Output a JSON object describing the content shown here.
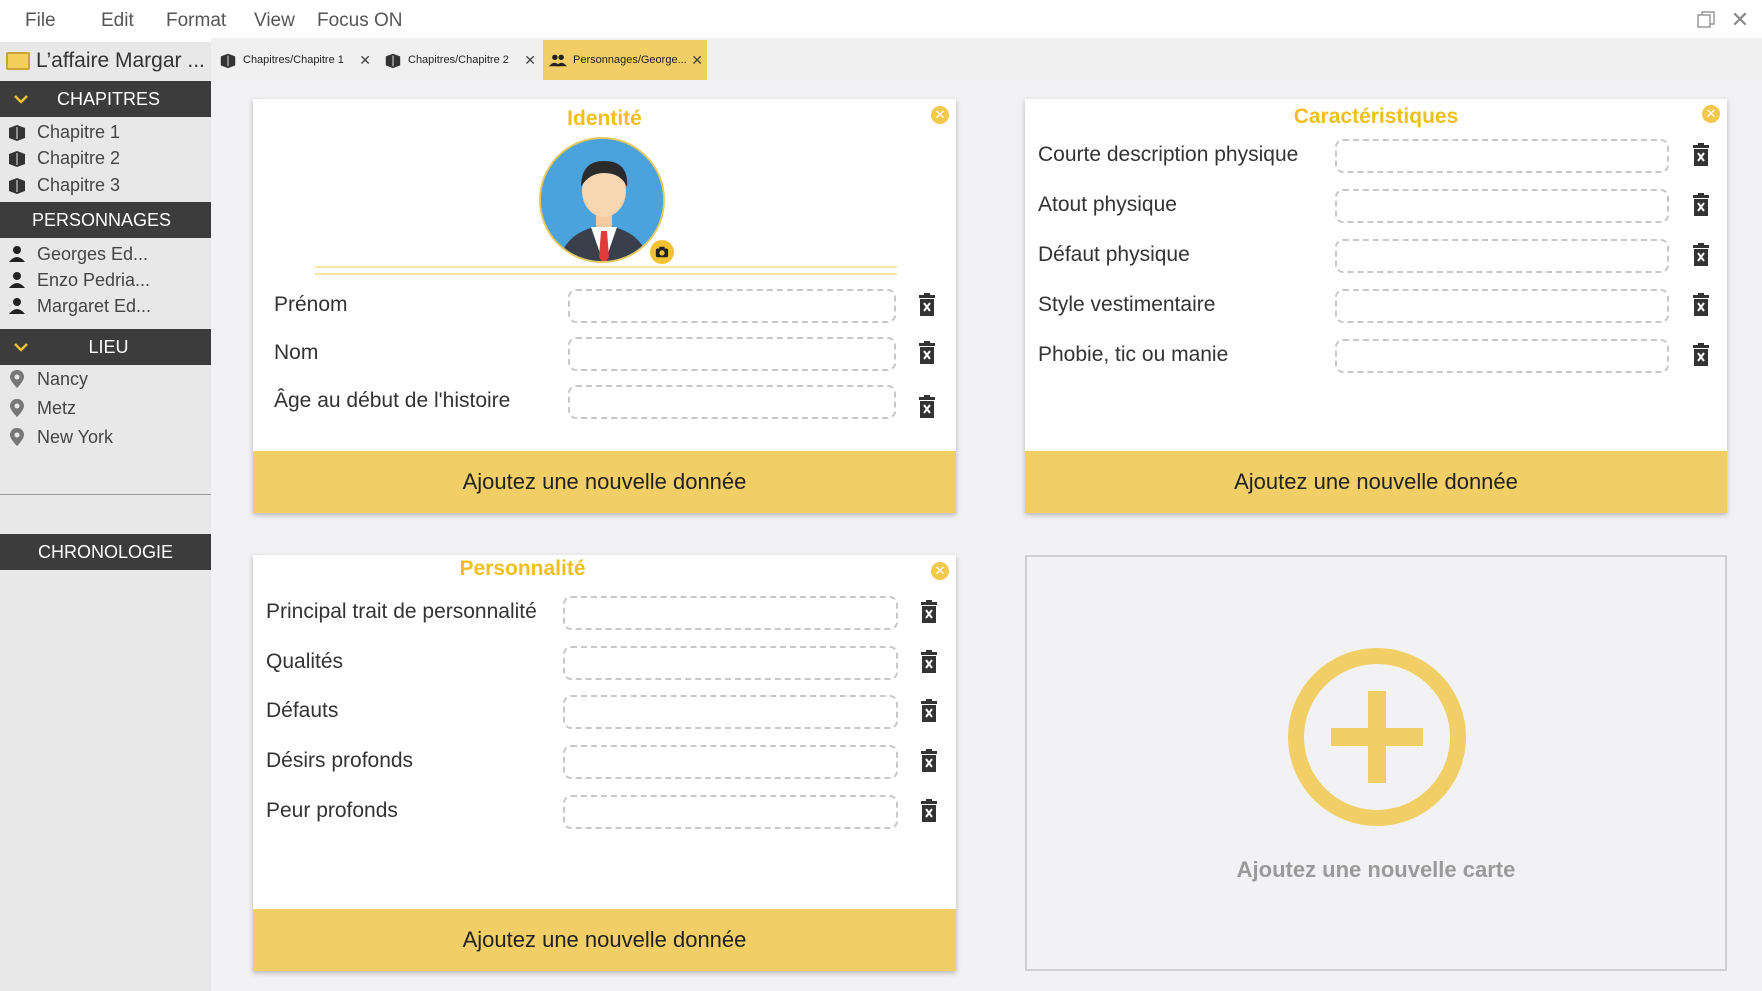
{
  "menu": {
    "file": "File",
    "edit": "Edit",
    "format": "Format",
    "view": "View",
    "focus": "Focus ON"
  },
  "project": {
    "title": "L’affaire Margar ..."
  },
  "sidebar": {
    "chapitres": {
      "header": "CHAPITRES",
      "items": [
        "Chapitre 1",
        "Chapitre 2",
        "Chapitre 3"
      ]
    },
    "personnages": {
      "header": "PERSONNAGES",
      "items": [
        "Georges Ed...",
        "Enzo Pedria...",
        "Margaret Ed..."
      ]
    },
    "lieu": {
      "header": "LIEU",
      "items": [
        "Nancy",
        "Metz",
        "New York"
      ]
    },
    "chronologie": "CHRONOLOGIE"
  },
  "tabs": [
    {
      "label": "Chapitres/Chapitre 1",
      "icon": "book-icon",
      "active": false
    },
    {
      "label": "Chapitres/Chapitre 2",
      "icon": "book-icon",
      "active": false
    },
    {
      "label": "Personnages/George...",
      "icon": "people-icon",
      "active": true
    }
  ],
  "cards": {
    "identite": {
      "title": "Identité",
      "fields": [
        {
          "label": "Prénom",
          "value": ""
        },
        {
          "label": "Nom",
          "value": ""
        },
        {
          "label": "Âge au début de l'histoire",
          "value": ""
        }
      ],
      "add_label": "Ajoutez une nouvelle donnée"
    },
    "caracteristiques": {
      "title": "Caractéristiques",
      "fields": [
        {
          "label": "Courte description physique",
          "value": ""
        },
        {
          "label": "Atout physique",
          "value": ""
        },
        {
          "label": "Défaut physique",
          "value": ""
        },
        {
          "label": "Style vestimentaire",
          "value": ""
        },
        {
          "label": "Phobie, tic ou manie",
          "value": ""
        }
      ],
      "add_label": "Ajoutez une nouvelle donnée"
    },
    "personnalite": {
      "title": "Personnalité",
      "fields": [
        {
          "label": "Principal trait de personnalité",
          "value": ""
        },
        {
          "label": "Qualités",
          "value": ""
        },
        {
          "label": "Défauts",
          "value": ""
        },
        {
          "label": "Désirs profonds",
          "value": ""
        },
        {
          "label": "Peur profonds",
          "value": ""
        }
      ],
      "add_label": "Ajoutez une nouvelle donnée"
    },
    "new_card": {
      "label": "Ajoutez une nouvelle carte"
    }
  },
  "colors": {
    "accent": "#f2cf66",
    "title": "#efbf20",
    "sidebar_header": "#3c3c3c",
    "sidebar_bg": "#e8e8e8"
  }
}
